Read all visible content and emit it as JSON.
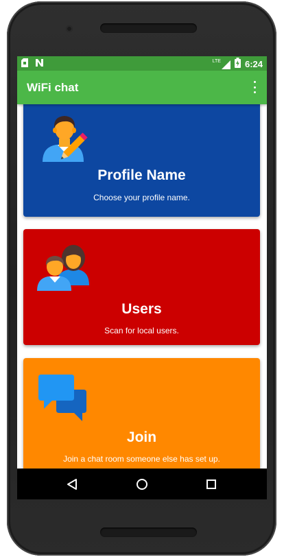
{
  "status_bar": {
    "left_icons": [
      "sim-card-icon",
      "notification-n-icon"
    ],
    "right_icons": [
      "lte-signal-icon",
      "battery-charging-icon"
    ],
    "network_label": "LTE",
    "time": "6:24"
  },
  "app_bar": {
    "title": "WiFi chat",
    "menu_icon": "overflow-menu-icon"
  },
  "cards": [
    {
      "title": "Profile Name",
      "description": "Choose your profile name.",
      "icon": "user-edit-icon",
      "color": "#0d47a1"
    },
    {
      "title": "Users",
      "description": "Scan for local users.",
      "icon": "users-icon",
      "color": "#cc0000"
    },
    {
      "title": "Join",
      "description": "Join a chat room someone else has set up.",
      "icon": "chat-bubbles-icon",
      "color": "#ff8800"
    }
  ],
  "nav_bar": {
    "back_icon": "back-icon",
    "home_icon": "home-icon",
    "recents_icon": "recents-icon"
  },
  "colors": {
    "status_bar": "#3f9b3a",
    "app_bar": "#4cb748",
    "nav_bar": "#000000"
  }
}
